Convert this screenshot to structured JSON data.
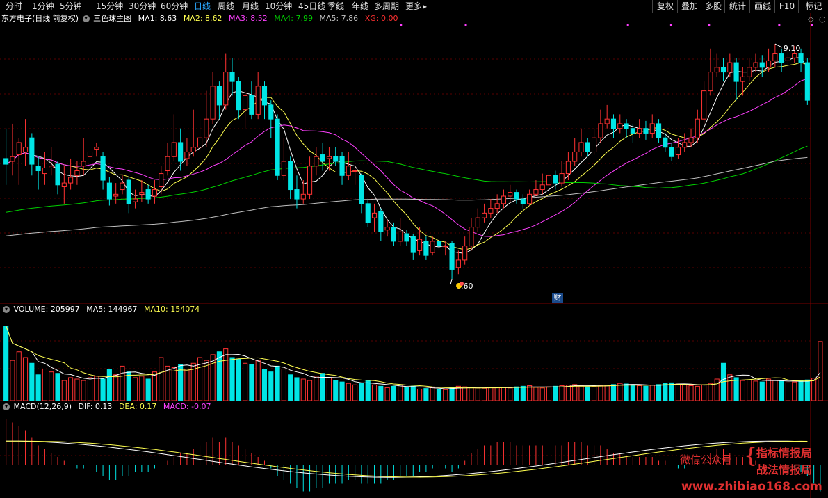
{
  "toolbar": {
    "periods": [
      "分时",
      "1分钟",
      "5分钟",
      "15分钟",
      "30分钟",
      "60分钟",
      "日线",
      "周线",
      "月线",
      "10分钟",
      "45日线",
      "季线",
      "年线",
      "多周期",
      "更多"
    ],
    "active_period": "日线",
    "more_arrow": "▸",
    "right_items": [
      "复权",
      "叠加",
      "多股",
      "统计",
      "画线",
      "F10",
      "标记"
    ]
  },
  "main": {
    "stock": "东方电子",
    "mode": "(日线 前复权)",
    "indicator": "三色球主图",
    "ma1": "MA1: 8.63",
    "ma2": "MA2: 8.62",
    "ma3": "MA3: 8.52",
    "ma4": "MA4: 7.99",
    "ma5": "MA5: 7.86",
    "xg": "XG: 0.00",
    "high_label": "9.10",
    "low_label": "6.60",
    "fin_marker": "财"
  },
  "volume": {
    "label": "VOLUME: 205997",
    "ma5": "MA5: 144967",
    "ma10": "MA10: 154074"
  },
  "macd": {
    "label": "MACD(12,26,9)",
    "dif": "DIF: 0.13",
    "dea": "DEA: 0.17",
    "macd": "MACD: -0.07"
  },
  "watermark": {
    "label": "微信公众号",
    "brace": "{",
    "line1": "指标情报局",
    "line2": "战法情报局",
    "url": "www.zhibiao168.com"
  },
  "colors": {
    "up": "#ff3232",
    "down": "#00e5e5",
    "ma1": "#ffffff",
    "ma2": "#ffff50",
    "ma3": "#ff40ff",
    "ma4": "#00d000",
    "ma5": "#c0c0c0",
    "xg": "#ff3030",
    "accent": "#2aa8ff"
  },
  "chart_data": {
    "type": "candlestick",
    "price_range": [
      6.4,
      9.3
    ],
    "price_high": 9.1,
    "price_low": 6.6,
    "candles": [
      [
        7.88,
        7.82,
        8.2,
        7.6
      ],
      [
        7.85,
        7.9,
        8.25,
        7.7
      ],
      [
        7.92,
        8.05,
        8.1,
        7.6
      ],
      [
        7.95,
        8.0,
        8.3,
        7.8
      ],
      [
        8.1,
        7.82,
        8.15,
        7.7
      ],
      [
        7.8,
        7.75,
        7.9,
        7.55
      ],
      [
        7.72,
        7.78,
        7.95,
        7.6
      ],
      [
        7.78,
        7.8,
        8.0,
        7.7
      ],
      [
        7.82,
        7.6,
        7.85,
        7.5
      ],
      [
        7.58,
        7.62,
        7.8,
        7.4
      ],
      [
        7.62,
        7.68,
        7.88,
        7.55
      ],
      [
        7.7,
        7.75,
        7.85,
        7.6
      ],
      [
        7.8,
        7.85,
        8.1,
        7.7
      ],
      [
        7.9,
        7.95,
        8.15,
        7.8
      ],
      [
        7.98,
        8.0,
        8.05,
        7.9
      ],
      [
        7.9,
        7.65,
        7.95,
        7.55
      ],
      [
        7.62,
        7.45,
        7.68,
        7.38
      ],
      [
        7.48,
        7.5,
        7.62,
        7.4
      ],
      [
        7.55,
        7.62,
        7.7,
        7.5
      ],
      [
        7.65,
        7.4,
        7.68,
        7.3
      ],
      [
        7.42,
        7.45,
        7.55,
        7.35
      ],
      [
        7.5,
        7.52,
        7.65,
        7.42
      ],
      [
        7.55,
        7.45,
        7.6,
        7.4
      ],
      [
        7.48,
        7.55,
        7.65,
        7.4
      ],
      [
        7.58,
        7.72,
        7.8,
        7.5
      ],
      [
        7.75,
        7.9,
        8.05,
        7.7
      ],
      [
        7.9,
        8.05,
        8.35,
        7.85
      ],
      [
        8.05,
        7.85,
        8.2,
        7.75
      ],
      [
        7.88,
        7.95,
        8.1,
        7.8
      ],
      [
        7.95,
        8.0,
        8.4,
        7.9
      ],
      [
        8.0,
        8.1,
        8.3,
        7.95
      ],
      [
        8.1,
        8.3,
        8.6,
        8.0
      ],
      [
        8.3,
        8.65,
        8.8,
        8.25
      ],
      [
        8.65,
        8.45,
        8.7,
        8.3
      ],
      [
        8.45,
        8.8,
        9.0,
        8.4
      ],
      [
        8.8,
        8.7,
        8.95,
        8.55
      ],
      [
        8.7,
        8.4,
        8.75,
        8.3
      ],
      [
        8.4,
        8.55,
        8.6,
        8.2
      ],
      [
        8.55,
        8.35,
        8.7,
        8.3
      ],
      [
        8.35,
        8.65,
        8.8,
        8.3
      ],
      [
        8.65,
        8.45,
        8.7,
        8.3
      ],
      [
        8.45,
        8.3,
        8.5,
        8.1
      ],
      [
        8.3,
        7.7,
        8.35,
        7.65
      ],
      [
        7.7,
        7.85,
        8.1,
        7.65
      ],
      [
        7.85,
        7.55,
        7.9,
        7.45
      ],
      [
        7.55,
        7.45,
        7.7,
        7.35
      ],
      [
        7.45,
        7.5,
        7.65,
        7.4
      ],
      [
        7.5,
        7.8,
        7.9,
        7.45
      ],
      [
        7.8,
        7.9,
        8.0,
        7.7
      ],
      [
        7.92,
        7.85,
        8.05,
        7.75
      ],
      [
        7.88,
        7.9,
        8.0,
        7.75
      ],
      [
        7.9,
        7.85,
        8.0,
        7.8
      ],
      [
        7.9,
        7.7,
        7.95,
        7.6
      ],
      [
        7.7,
        7.8,
        7.95,
        7.65
      ],
      [
        7.75,
        7.75,
        7.8,
        7.6
      ],
      [
        7.7,
        7.4,
        7.72,
        7.3
      ],
      [
        7.4,
        7.2,
        7.45,
        7.15
      ],
      [
        7.25,
        7.3,
        7.4,
        7.1
      ],
      [
        7.32,
        7.1,
        7.35,
        7.0
      ],
      [
        7.12,
        7.15,
        7.22,
        7.05
      ],
      [
        7.15,
        7.0,
        7.2,
        6.95
      ],
      [
        7.0,
        7.1,
        7.25,
        6.95
      ],
      [
        7.08,
        7.0,
        7.12,
        6.95
      ],
      [
        7.05,
        6.88,
        7.08,
        6.8
      ],
      [
        6.9,
        7.02,
        7.15,
        6.85
      ],
      [
        7.0,
        6.85,
        7.05,
        6.8
      ],
      [
        6.88,
        7.0,
        7.05,
        6.85
      ],
      [
        7.0,
        6.95,
        7.05,
        6.9
      ],
      [
        6.95,
        6.95,
        7.0,
        6.85
      ],
      [
        6.98,
        6.7,
        7.0,
        6.6
      ],
      [
        6.72,
        6.8,
        6.9,
        6.65
      ],
      [
        6.8,
        6.95,
        7.05,
        6.75
      ],
      [
        6.95,
        7.15,
        7.25,
        6.9
      ],
      [
        7.15,
        7.25,
        7.35,
        7.1
      ],
      [
        7.25,
        7.3,
        7.4,
        7.2
      ],
      [
        7.3,
        7.35,
        7.45,
        7.25
      ],
      [
        7.35,
        7.4,
        7.5,
        7.3
      ],
      [
        7.4,
        7.48,
        7.55,
        7.35
      ],
      [
        7.48,
        7.52,
        7.6,
        7.42
      ],
      [
        7.52,
        7.45,
        7.55,
        7.4
      ],
      [
        7.45,
        7.4,
        7.5,
        7.35
      ],
      [
        7.4,
        7.5,
        7.55,
        7.38
      ],
      [
        7.5,
        7.55,
        7.65,
        7.48
      ],
      [
        7.55,
        7.6,
        7.72,
        7.5
      ],
      [
        7.6,
        7.7,
        7.8,
        7.55
      ],
      [
        7.7,
        7.62,
        7.75,
        7.55
      ],
      [
        7.62,
        7.72,
        7.85,
        7.58
      ],
      [
        7.72,
        7.85,
        7.95,
        7.65
      ],
      [
        7.85,
        7.95,
        8.1,
        7.8
      ],
      [
        7.95,
        8.05,
        8.2,
        7.9
      ],
      [
        8.05,
        7.95,
        8.1,
        7.9
      ],
      [
        7.95,
        8.1,
        8.2,
        7.92
      ],
      [
        8.1,
        8.25,
        8.4,
        8.05
      ],
      [
        8.25,
        8.3,
        8.45,
        8.2
      ],
      [
        8.3,
        8.2,
        8.35,
        8.1
      ],
      [
        8.2,
        8.25,
        8.35,
        8.15
      ],
      [
        8.25,
        8.2,
        8.3,
        8.1
      ],
      [
        8.2,
        8.15,
        8.25,
        8.05
      ],
      [
        8.15,
        8.2,
        8.3,
        8.1
      ],
      [
        8.2,
        8.15,
        8.28,
        8.08
      ],
      [
        8.15,
        8.25,
        8.35,
        8.1
      ],
      [
        8.25,
        8.1,
        8.3,
        8.05
      ],
      [
        8.1,
        8.0,
        8.15,
        7.95
      ],
      [
        8.0,
        7.9,
        8.05,
        7.85
      ],
      [
        7.92,
        8.0,
        8.1,
        7.88
      ],
      [
        8.0,
        8.05,
        8.15,
        7.95
      ],
      [
        8.05,
        8.1,
        8.2,
        8.0
      ],
      [
        8.1,
        8.3,
        8.4,
        8.05
      ],
      [
        8.3,
        8.6,
        8.7,
        8.25
      ],
      [
        8.6,
        8.8,
        9.05,
        8.55
      ],
      [
        8.8,
        8.85,
        9.0,
        8.75
      ],
      [
        8.85,
        8.8,
        8.95,
        8.7
      ],
      [
        8.8,
        8.9,
        9.0,
        8.75
      ],
      [
        8.9,
        8.7,
        8.95,
        8.5
      ],
      [
        8.7,
        8.75,
        8.85,
        8.55
      ],
      [
        8.75,
        8.85,
        8.95,
        8.7
      ],
      [
        8.85,
        8.9,
        9.0,
        8.8
      ],
      [
        8.9,
        8.85,
        8.98,
        8.75
      ],
      [
        8.85,
        8.92,
        9.05,
        8.8
      ],
      [
        8.92,
        9.0,
        9.1,
        8.85
      ],
      [
        9.0,
        8.9,
        9.05,
        8.8
      ],
      [
        8.92,
        8.95,
        9.05,
        8.85
      ],
      [
        8.95,
        9.0,
        9.08,
        8.9
      ],
      [
        9.0,
        8.9,
        9.05,
        8.8
      ],
      [
        8.9,
        8.5,
        8.95,
        8.45
      ]
    ],
    "ma_series": [
      {
        "name": "MA1",
        "period": 5
      },
      {
        "name": "MA2",
        "period": 10
      },
      {
        "name": "MA3",
        "period": 20
      },
      {
        "name": "MA4",
        "period": 60
      },
      {
        "name": "MA5",
        "period": 120
      }
    ],
    "volume": [
      260000,
      140000,
      170000,
      150000,
      130000,
      90000,
      110000,
      100000,
      95000,
      70000,
      80000,
      75000,
      70000,
      80000,
      85000,
      75000,
      110000,
      90000,
      120000,
      100000,
      80000,
      85000,
      75000,
      100000,
      150000,
      120000,
      115000,
      125000,
      110000,
      130000,
      150000,
      140000,
      160000,
      170000,
      180000,
      150000,
      145000,
      130000,
      125000,
      140000,
      110000,
      100000,
      120000,
      110000,
      90000,
      80000,
      75000,
      70000,
      85000,
      95000,
      80000,
      70000,
      65000,
      60000,
      55000,
      60000,
      70000,
      55000,
      50000,
      45000,
      50000,
      55000,
      45000,
      50000,
      40000,
      42000,
      45000,
      40000,
      38000,
      45000,
      50000,
      48000,
      46000,
      44000,
      43000,
      45000,
      47000,
      46000,
      44000,
      48000,
      50000,
      52000,
      46000,
      44000,
      48000,
      50000,
      52000,
      54000,
      56000,
      52000,
      48000,
      50000,
      52000,
      54000,
      56000,
      60000,
      58000,
      55000,
      52000,
      50000,
      54000,
      56000,
      60000,
      62000,
      58000,
      56000,
      52000,
      50000,
      55000,
      60000,
      75000,
      130000,
      90000,
      80000,
      70000,
      72000,
      68000,
      65000,
      75000,
      70000,
      68000,
      62000,
      65000,
      70000,
      72000,
      78000,
      205997
    ],
    "macd_hist": [
      0.12,
      0.11,
      0.1,
      0.09,
      0.07,
      0.05,
      0.04,
      0.03,
      0.02,
      0.01,
      0.0,
      -0.01,
      -0.01,
      -0.02,
      -0.02,
      -0.03,
      -0.04,
      -0.04,
      -0.03,
      -0.03,
      -0.02,
      -0.02,
      -0.02,
      -0.01,
      0.0,
      0.01,
      0.02,
      0.03,
      0.03,
      0.04,
      0.05,
      0.06,
      0.07,
      0.06,
      0.07,
      0.06,
      0.05,
      0.04,
      0.03,
      0.02,
      0.01,
      -0.01,
      -0.03,
      -0.04,
      -0.05,
      -0.06,
      -0.07,
      -0.07,
      -0.06,
      -0.06,
      -0.05,
      -0.05,
      -0.05,
      -0.04,
      -0.04,
      -0.05,
      -0.05,
      -0.05,
      -0.05,
      -0.04,
      -0.04,
      -0.03,
      -0.03,
      -0.03,
      -0.02,
      -0.02,
      -0.01,
      -0.01,
      -0.01,
      -0.02,
      -0.01,
      0.01,
      0.03,
      0.04,
      0.05,
      0.05,
      0.06,
      0.06,
      0.06,
      0.05,
      0.05,
      0.05,
      0.05,
      0.05,
      0.06,
      0.05,
      0.05,
      0.06,
      0.06,
      0.06,
      0.05,
      0.05,
      0.05,
      0.04,
      0.03,
      0.03,
      0.02,
      0.02,
      0.02,
      0.02,
      0.02,
      0.01,
      0.01,
      0.0,
      -0.01,
      -0.01,
      0.0,
      0.01,
      0.02,
      0.03,
      0.04,
      0.04,
      0.03,
      0.02,
      0.02,
      0.01,
      0.01,
      0.0,
      0.0,
      0.0,
      0.0,
      -0.01,
      -0.01,
      -0.02,
      -0.03,
      -0.05,
      -0.07
    ]
  }
}
